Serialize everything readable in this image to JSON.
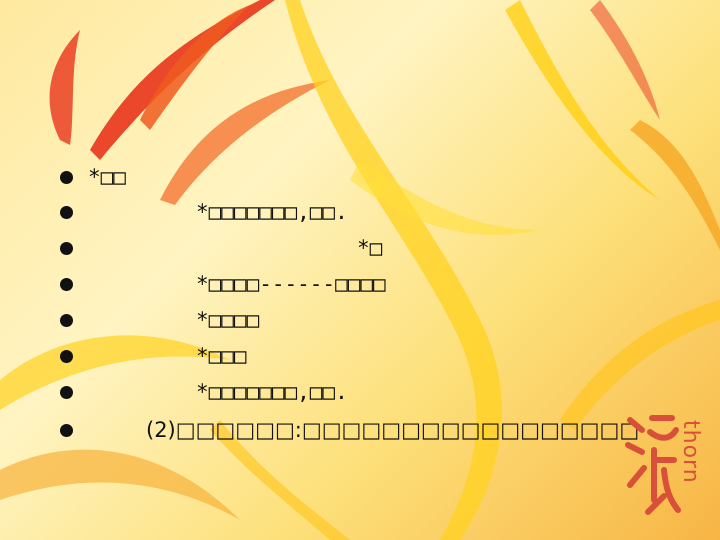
{
  "lines": [
    "*□□",
    "*□□□□□□□,□□.",
    "*□",
    "*□□□□------□□□□",
    "*□□□□",
    "*□□□",
    "*□□□□□□□,□□.",
    "(2)□□□□□□:□□□□□□□□□□□□□□□□□"
  ],
  "logo": {
    "word": "thorn",
    "color": "#d9503a"
  },
  "colors": {
    "background_light": "#fff4c2",
    "background_warm": "#f7b545",
    "accent_red": "#e8341c",
    "accent_yellow": "#ffd21f"
  }
}
